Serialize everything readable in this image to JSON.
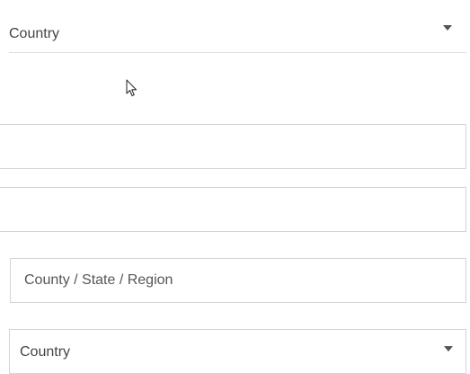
{
  "shipping_country_select": {
    "label": "Country"
  },
  "region_input": {
    "placeholder": "County / State / Region"
  },
  "country_select": {
    "label": "Country"
  },
  "icons": {
    "dropdown": "chevron-down-icon",
    "cursor": "mouse-pointer-icon"
  }
}
